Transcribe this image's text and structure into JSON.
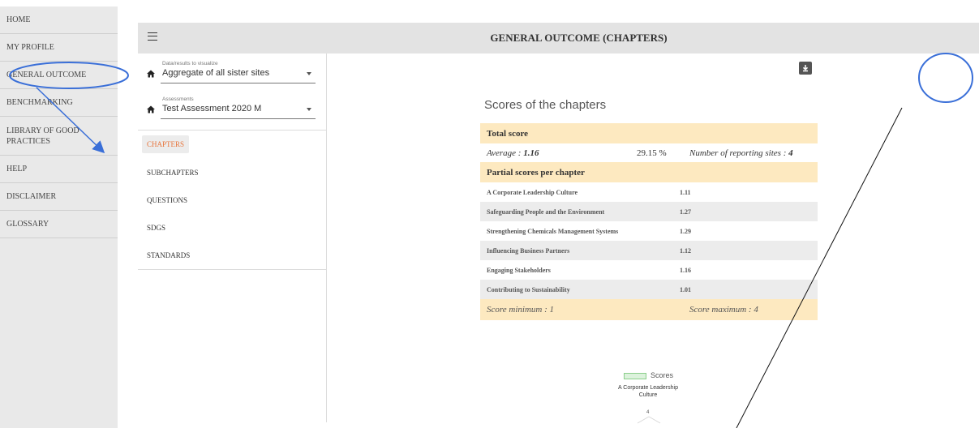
{
  "nav": {
    "items": [
      {
        "label": "HOME"
      },
      {
        "label": "MY PROFILE"
      },
      {
        "label": "GENERAL OUTCOME"
      },
      {
        "label": "BENCHMARKING"
      },
      {
        "label": "LIBRARY OF GOOD PRACTICES"
      },
      {
        "label": "HELP"
      },
      {
        "label": "DISCLAIMER"
      },
      {
        "label": "GLOSSARY"
      }
    ]
  },
  "header": {
    "title": "GENERAL OUTCOME (CHAPTERS)"
  },
  "filters": {
    "data_select": {
      "label": "Data/results to visualize",
      "value": "Aggregate of all sister sites"
    },
    "assessment_select": {
      "label": "Assessments",
      "value": "Test Assessment 2020 M"
    }
  },
  "menu": {
    "items": [
      {
        "label": "CHAPTERS",
        "active": true
      },
      {
        "label": "SUBCHAPTERS"
      },
      {
        "label": "QUESTIONS"
      },
      {
        "label": "SDGs"
      },
      {
        "label": "STANDARDS"
      }
    ]
  },
  "scores": {
    "title": "Scores of the chapters",
    "total_header": "Total score",
    "average_label": "Average : ",
    "average_value": "1.16",
    "percent": "29.15 %",
    "sites_label": "Number of reporting sites : ",
    "sites_value": "4",
    "partial_header": "Partial scores per chapter",
    "chapters": [
      {
        "name": "A Corporate Leadership Culture",
        "score": "1.11"
      },
      {
        "name": "Safeguarding People and the Environment",
        "score": "1.27"
      },
      {
        "name": "Strengthening Chemicals Management Systems",
        "score": "1.29"
      },
      {
        "name": "Influencing Business Partners",
        "score": "1.12"
      },
      {
        "name": "Engaging Stakeholders",
        "score": "1.16"
      },
      {
        "name": "Contributing to Sustainability",
        "score": "1.01"
      }
    ],
    "min_label": "Score minimum : 1",
    "max_label": "Score maximum : 4"
  },
  "chart": {
    "legend": "Scores",
    "axis_label_first": "A Corporate Leadership Culture",
    "tick_max": "4"
  },
  "colors": {
    "nav_bg": "#e9e9e9",
    "header_bg": "#fde9c0",
    "active_accent": "#e8743b",
    "annotation": "#3a6fd8"
  }
}
